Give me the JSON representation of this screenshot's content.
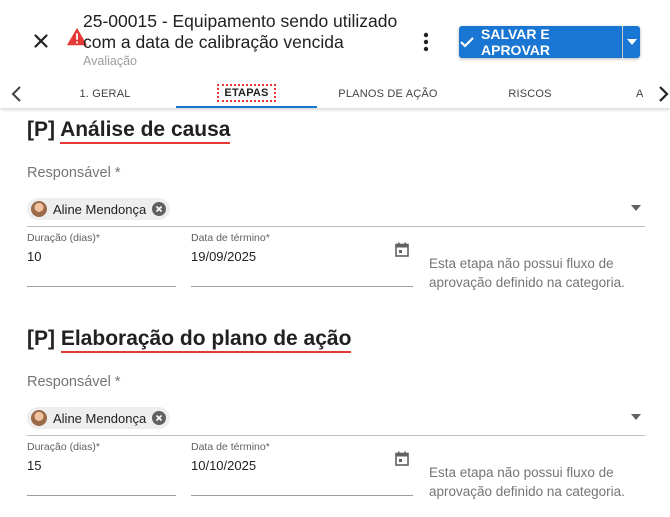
{
  "header": {
    "title": "25-00015 - Equipamento sendo utilizado com a data de calibração vencida",
    "subtitle": "Avaliação",
    "save_label": "SALVAR E APROVAR"
  },
  "tabs": [
    {
      "label": "1. GERAL"
    },
    {
      "label": "ETAPAS"
    },
    {
      "label": "PLANOS DE AÇÃO"
    },
    {
      "label": "RISCOS"
    },
    {
      "label": "A"
    }
  ],
  "sections": [
    {
      "title_prefix": "[P]",
      "title": "Análise de causa",
      "responsible_label": "Responsável *",
      "responsible": "Aline Mendonça",
      "duration_label": "Duração (dias)*",
      "duration": "10",
      "end_date_label": "Data de término*",
      "end_date": "19/09/2025",
      "note": "Esta etapa não possui fluxo de aprovação definido na categoria."
    },
    {
      "title_prefix": "[P]",
      "title": "Elaboração do plano de ação",
      "responsible_label": "Responsável *",
      "responsible": "Aline Mendonça",
      "duration_label": "Duração (dias)*",
      "duration": "15",
      "end_date_label": "Data de término*",
      "end_date": "10/10/2025",
      "note": "Esta etapa não possui fluxo de aprovação definido na categoria."
    }
  ],
  "colors": {
    "accent": "#f57c00",
    "primary": "#1976d2",
    "highlight": "#e53935"
  },
  "icons": [
    "close-icon",
    "warning-icon",
    "more-vert-icon",
    "check-icon",
    "chevron-down-icon",
    "chevron-left-icon",
    "chevron-right-icon",
    "calendar-icon",
    "chip-remove-icon"
  ]
}
